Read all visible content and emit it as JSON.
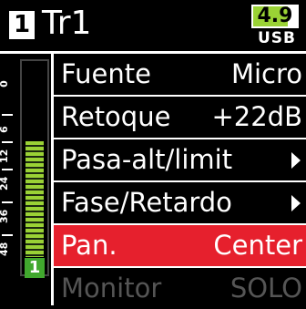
{
  "header": {
    "track_number": "1",
    "track_name": "Tr1",
    "battery": {
      "value": "4.9",
      "fill_fraction": 0.8
    },
    "power_source": "USB"
  },
  "meter": {
    "scale": [
      "48",
      "36",
      "24",
      "12",
      "6",
      "0"
    ],
    "level_fraction": 0.55,
    "channel": "1",
    "colors": {
      "bar": "#9ad235",
      "channel_badge": "#41a82e"
    }
  },
  "menu": {
    "items": [
      {
        "label": "Fuente",
        "value": "Micro"
      },
      {
        "label": "Retoque",
        "value": "+22dB"
      },
      {
        "label": "Pasa-alt/limit",
        "submenu": true
      },
      {
        "label": "Fase/Retardo",
        "submenu": true
      },
      {
        "label": "Pan.",
        "value": "Center",
        "selected": true
      },
      {
        "label": "Monitor",
        "value": "SOLO",
        "disabled": true
      }
    ],
    "colors": {
      "selected": "#e6202d",
      "disabled": "#555555"
    }
  }
}
